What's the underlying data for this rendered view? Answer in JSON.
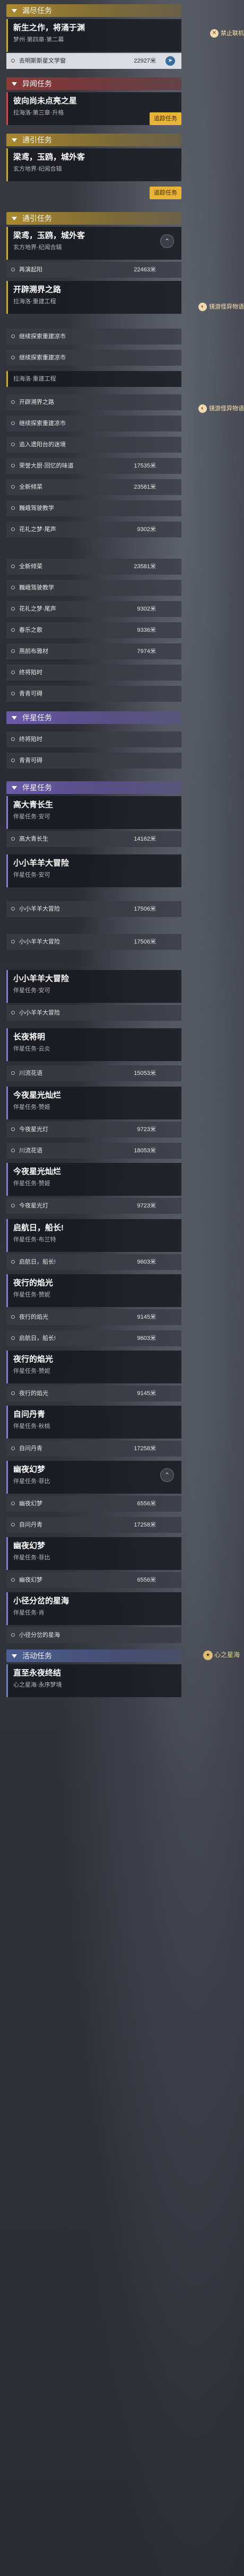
{
  "colors": {
    "yellow": "#c9a94a",
    "red": "#b9504c",
    "purple": "#8f7ad0",
    "blue": "#6f80b9"
  },
  "sections": {
    "daily": "漏尽任务",
    "other": "异闻任务",
    "main": "通引任务",
    "companion": "伴星任务",
    "activity": "活动任务"
  },
  "side": {
    "disconnect": "禁止联机",
    "nav_logo_1": "镜游怪异物语",
    "nav_logo_2": "镜游怪异物语",
    "corner": "心之星海"
  },
  "toasts": {
    "t1": "追踪任务",
    "t2": "追踪任务"
  },
  "quests": [
    {
      "title": "新生之作，将涌于渊",
      "loc": "梦州·第四章·第二幕"
    },
    {
      "title": "彼向尚未点亮之星",
      "loc": "拉海洛·第三章·升格"
    },
    {
      "title": "梁鸢，玉鸥，城外客",
      "loc": "玄方地界·纪闻合辑"
    },
    {
      "title": "梁鸢，玉鸥，城外客",
      "loc": "玄方地界·纪闻合辑"
    },
    {
      "title": "开辟溯界之路",
      "loc": "拉海洛·重建工程"
    },
    {
      "title": "长夜将明",
      "loc": "伴星任务·云炎"
    },
    {
      "title": "高大青长生",
      "loc": "伴星任务·安可"
    },
    {
      "title": "小小羊羊大冒险",
      "loc": "伴星任务·安可"
    },
    {
      "title": "小小羊羊大冒险",
      "loc": "伴星任务·安可"
    },
    {
      "title": "长夜将明",
      "loc": "伴星任务·云炎"
    },
    {
      "title": "今夜星光灿烂",
      "loc": "伴星任务·赞姬"
    },
    {
      "title": "今夜星光灿烂",
      "loc": "伴星任务·赞姬"
    },
    {
      "title": "启航日，船长!",
      "loc": "伴星任务·布兰特"
    },
    {
      "title": "夜行的焰光",
      "loc": "伴星任务·赞妮"
    },
    {
      "title": "夜行的焰光",
      "loc": "伴星任务·赞妮"
    },
    {
      "title": "自问丹青",
      "loc": "伴星任务·秋桃"
    },
    {
      "title": "幽夜幻梦",
      "loc": "伴星任务·菲比"
    },
    {
      "title": "幽夜幻梦",
      "loc": "伴星任务·菲比"
    },
    {
      "title": "小径分岔的星海",
      "loc": "伴星任务·肖"
    },
    {
      "title": "直至永夜终结",
      "loc": "心之星海·永序梦境"
    }
  ],
  "subs": [
    {
      "label": "去明斯斯星文学窗",
      "dist": "22927米"
    },
    {
      "label": "再演起阳",
      "dist": "22463米"
    },
    {
      "label": "继续探索重建凉市",
      "dist": ""
    },
    {
      "label": "继续探索重建凉市",
      "dist": ""
    },
    {
      "label": "开辟溯界之路",
      "dist": ""
    },
    {
      "label": "继续探索重建凉市",
      "dist": ""
    },
    {
      "label": "追入遗阳台的迷境",
      "dist": ""
    },
    {
      "label": "荣誉大厨·回忆的味道",
      "dist": "17535米"
    },
    {
      "label": "全新倾菜",
      "dist": "23581米"
    },
    {
      "label": "巍峨驾驶教学",
      "dist": ""
    },
    {
      "label": "花礼之梦·尾声",
      "dist": "9302米"
    },
    {
      "label": "全新倾菜",
      "dist": "23581米"
    },
    {
      "label": "巍峨驾驶教学",
      "dist": ""
    },
    {
      "label": "花礼之梦·尾声",
      "dist": "9302米"
    },
    {
      "label": "春乐之歌",
      "dist": "9336米"
    },
    {
      "label": "燕前布雅材",
      "dist": "7974米"
    },
    {
      "label": "终将陷时",
      "dist": ""
    },
    {
      "label": "青青可碍",
      "dist": ""
    },
    {
      "label": "终将陷时",
      "dist": ""
    },
    {
      "label": "青青可碍",
      "dist": ""
    },
    {
      "label": "高大青长生",
      "dist": "14162米"
    },
    {
      "label": "小小羊羊大冒险",
      "dist": "17506米"
    },
    {
      "label": "小小羊羊大冒险",
      "dist": "17506米"
    },
    {
      "label": "川流花语",
      "dist": "15053米"
    },
    {
      "label": "今夜星光灯",
      "dist": "9723米"
    },
    {
      "label": "川流花语",
      "dist": "18053米"
    },
    {
      "label": "今夜星光灯",
      "dist": "9723米"
    },
    {
      "label": "启航日，船长!",
      "dist": "9603米"
    },
    {
      "label": "夜行的焰光",
      "dist": "9145米"
    },
    {
      "label": "启航日，船长!",
      "dist": "9603米"
    },
    {
      "label": "夜行的焰光",
      "dist": "9145米"
    },
    {
      "label": "自问丹青",
      "dist": "17258米"
    },
    {
      "label": "幽夜幻梦",
      "dist": "6556米"
    },
    {
      "label": "自问丹青",
      "dist": "17258米"
    },
    {
      "label": "幽夜幻梦",
      "dist": "6556米"
    },
    {
      "label": "小径分岔的星海",
      "dist": ""
    }
  ]
}
